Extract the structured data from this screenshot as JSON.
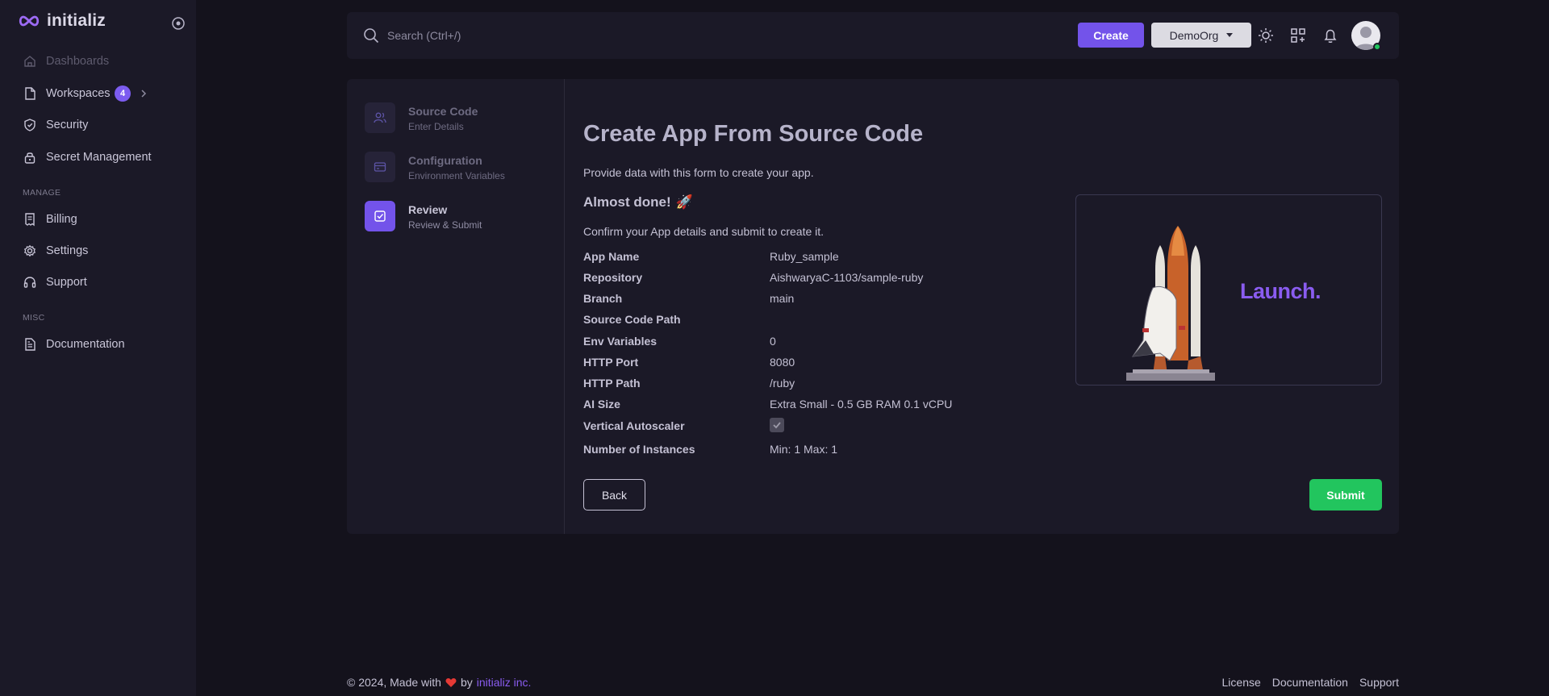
{
  "brand": {
    "name": "initializ"
  },
  "sidebar": {
    "items": [
      {
        "label": "Dashboards",
        "icon": "home-icon",
        "disabled": true
      },
      {
        "label": "Workspaces",
        "icon": "file-icon",
        "badge": "4"
      },
      {
        "label": "Security",
        "icon": "shield-icon"
      },
      {
        "label": "Secret Management",
        "icon": "lock-icon"
      }
    ],
    "manage_label": "MANAGE",
    "manage_items": [
      {
        "label": "Billing",
        "icon": "receipt-icon"
      },
      {
        "label": "Settings",
        "icon": "gear-icon"
      },
      {
        "label": "Support",
        "icon": "headset-icon"
      }
    ],
    "misc_label": "MISC",
    "misc_items": [
      {
        "label": "Documentation",
        "icon": "document-icon"
      }
    ]
  },
  "header": {
    "search_placeholder": "Search (Ctrl+/)",
    "create_label": "Create",
    "org_label": "DemoOrg"
  },
  "stepper": {
    "steps": [
      {
        "title": "Source Code",
        "subtitle": "Enter Details",
        "icon": "users-icon"
      },
      {
        "title": "Configuration",
        "subtitle": "Environment Variables",
        "icon": "card-icon"
      },
      {
        "title": "Review",
        "subtitle": "Review & Submit",
        "icon": "check-square-icon",
        "active": true
      }
    ]
  },
  "form": {
    "title": "Create App From Source Code",
    "description": "Provide data with this form to create your app.",
    "almost_done": "Almost done!",
    "almost_done_emoji": "🚀",
    "confirm_text": "Confirm your App details and submit to create it.",
    "details": [
      {
        "key": "App Name",
        "value": "Ruby_sample"
      },
      {
        "key": "Repository",
        "value": "AishwaryaC-1103/sample-ruby"
      },
      {
        "key": "Branch",
        "value": "main"
      },
      {
        "key": "Source Code Path",
        "value": ""
      },
      {
        "key": "Env Variables",
        "value": "0"
      },
      {
        "key": "HTTP Port",
        "value": "8080"
      },
      {
        "key": "HTTP Path",
        "value": "/ruby"
      },
      {
        "key": "AI Size",
        "value": "Extra Small - 0.5 GB RAM 0.1 vCPU"
      },
      {
        "key": "Vertical Autoscaler",
        "value": "",
        "checked": true
      },
      {
        "key": "Number of Instances",
        "value": "Min: 1 Max: 1"
      }
    ],
    "launch_text": "Launch.",
    "back_label": "Back",
    "submit_label": "Submit"
  },
  "footer": {
    "copyright": "© 2024, Made with",
    "by": "by",
    "company": "initializ inc.",
    "links": [
      "License",
      "Documentation",
      "Support"
    ]
  },
  "colors": {
    "accent": "#7353ea",
    "success": "#22c55e",
    "background": "#14121c",
    "panel": "#1b1927"
  }
}
